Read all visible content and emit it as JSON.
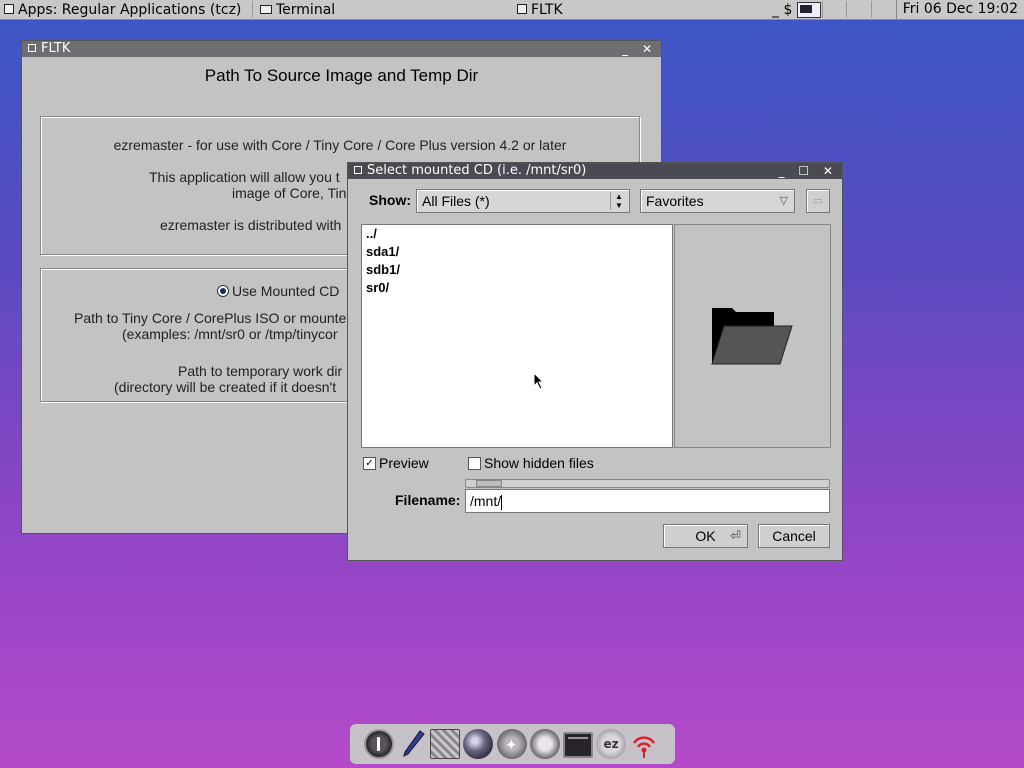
{
  "taskbar": {
    "apps_label": "Apps: Regular Applications (tcz)",
    "terminal_label": "Terminal",
    "fltk_label": "FLTK",
    "prompt_symbol": "_ $",
    "clock": "Fri 06 Dec 19:02"
  },
  "main_window": {
    "title": "FLTK",
    "heading": "Path To Source Image and Temp Dir",
    "info_line1": "ezremaster - for use with Core / Tiny Core / Core Plus version 4.2 or later",
    "info_line2": "This application will allow you t",
    "info_line3": "image of Core, Tin",
    "info_line4": "ezremaster is distributed with",
    "radio_label": "Use Mounted CD",
    "path_line1": "Path to Tiny Core / CorePlus ISO or mounte",
    "path_line2": "(examples:  /mnt/sr0 or  /tmp/tinycor",
    "temp_line1": "Path to temporary work dir",
    "temp_line2": "(directory will be created if it doesn't"
  },
  "file_dialog": {
    "title": "Select mounted CD (i.e. /mnt/sr0)",
    "show_label": "Show:",
    "show_value": "All Files (*)",
    "favorites_value": "Favorites",
    "files": [
      "../",
      "sda1/",
      "sdb1/",
      "sr0/"
    ],
    "preview_label": "Preview",
    "hidden_label": "Show hidden files",
    "filename_label": "Filename:",
    "filename_value": "/mnt/",
    "ok_label": "OK",
    "cancel_label": "Cancel"
  },
  "colors": {
    "desktop_top": "#3b57c6",
    "desktop_bottom": "#b54ac9",
    "window_bg": "#c3c3c3"
  },
  "icons": {
    "dock": [
      "power-icon",
      "editor-icon",
      "apps-icon",
      "mount-icon",
      "services-icon",
      "control-panel-icon",
      "terminal-icon",
      "ezremaster-icon",
      "wifi-icon"
    ],
    "preview": "folder-icon",
    "new_folder": "new-folder-icon"
  }
}
